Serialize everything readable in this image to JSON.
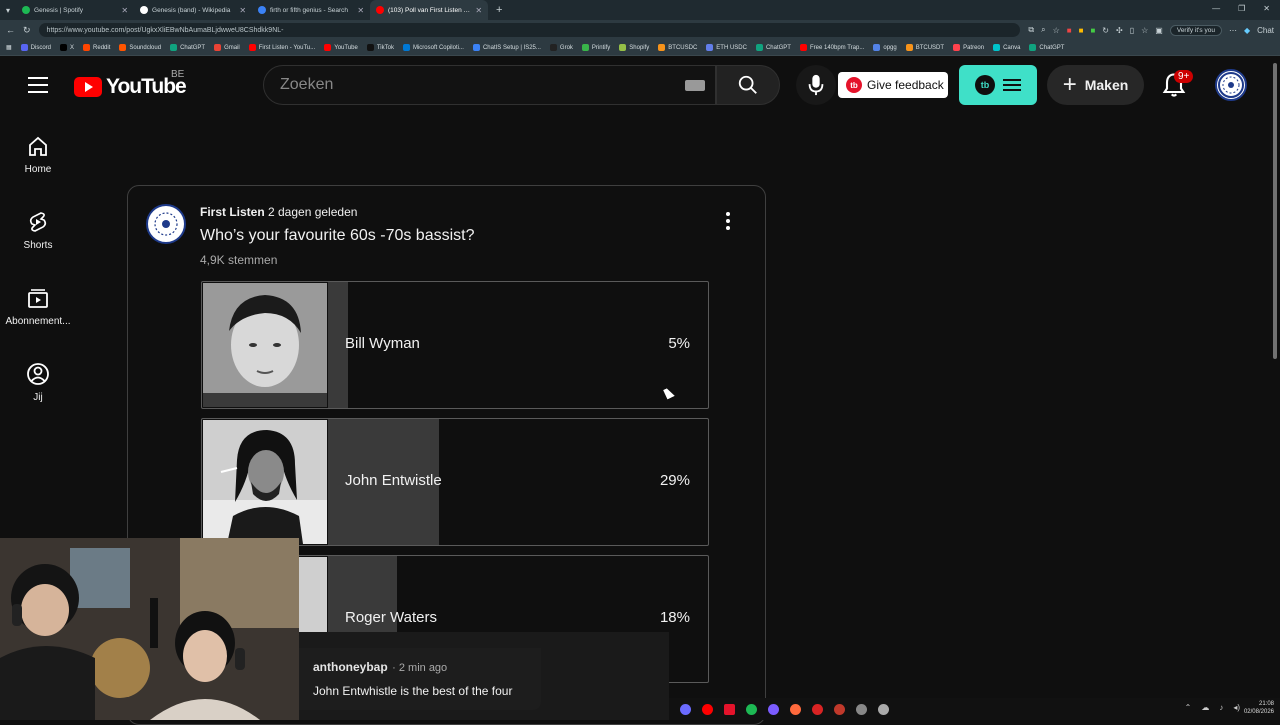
{
  "browser": {
    "tabs": [
      {
        "title": "Genesis | Spotify",
        "favicon_color": "#1db954",
        "active": false
      },
      {
        "title": "Genesis (band) - Wikipedia",
        "favicon_color": "#ffffff",
        "active": false
      },
      {
        "title": "firth or fifth genius - Search",
        "favicon_color": "#3b82f6",
        "active": false
      },
      {
        "title": "(103) Poll van First Listen - YouTub",
        "favicon_color": "#ff0000",
        "active": true
      }
    ],
    "url": "https://www.youtube.com/post/UgkxXliEBwNbAumaBLjdwweU8CShdkk9NL-",
    "verify_label": "Verify it's you",
    "chat_label": "Chat",
    "bookmarks": [
      {
        "label": "Discord",
        "color": "#5865f2"
      },
      {
        "label": "X",
        "color": "#000000"
      },
      {
        "label": "Reddit",
        "color": "#ff4500"
      },
      {
        "label": "Soundcloud",
        "color": "#ff5500"
      },
      {
        "label": "ChatGPT",
        "color": "#10a37f"
      },
      {
        "label": "Gmail",
        "color": "#ea4335"
      },
      {
        "label": "First Listen - YouTu...",
        "color": "#ff0000"
      },
      {
        "label": "YouTube",
        "color": "#ff0000"
      },
      {
        "label": "TikTok",
        "color": "#111111"
      },
      {
        "label": "Microsoft Copiloti...",
        "color": "#0078d4"
      },
      {
        "label": "ChatIS Setup | IS25...",
        "color": "#3b82f6"
      },
      {
        "label": "Grok",
        "color": "#222222"
      },
      {
        "label": "Printify",
        "color": "#39b54a"
      },
      {
        "label": "Shopify",
        "color": "#95bf47"
      },
      {
        "label": "BTCUSDC",
        "color": "#f7931a"
      },
      {
        "label": "ETH USDC",
        "color": "#627eea"
      },
      {
        "label": "ChatGPT",
        "color": "#10a37f"
      },
      {
        "label": "Free 140bpm Trap...",
        "color": "#ff0000"
      },
      {
        "label": "opgg",
        "color": "#5383e8"
      },
      {
        "label": "BTCUSDT",
        "color": "#f7931a"
      },
      {
        "label": "Patreon",
        "color": "#ff424d"
      },
      {
        "label": "Canva",
        "color": "#00c4cc"
      },
      {
        "label": "ChatGPT",
        "color": "#10a37f"
      }
    ]
  },
  "header": {
    "logo_text": "YouTube",
    "country": "BE",
    "search_placeholder": "Zoeken",
    "feedback_label": "Give feedback",
    "feedback_logo": "tb",
    "create_label": "Maken",
    "notif_badge": "9+"
  },
  "sidebar": {
    "items": [
      {
        "label": "Home",
        "icon": "home-icon"
      },
      {
        "label": "Shorts",
        "icon": "shorts-icon"
      },
      {
        "label": "Abonnement...",
        "icon": "subscriptions-icon"
      },
      {
        "label": "Jij",
        "icon": "you-icon"
      }
    ]
  },
  "post": {
    "channel": "First Listen",
    "time": "2 dagen geleden",
    "question": "Who’s your favourite 60s -70s bassist?",
    "votes": "4,9K stemmen",
    "options": [
      {
        "name": "Bill Wyman",
        "percent_label": "5%",
        "percent": 5
      },
      {
        "name": "John Entwistle",
        "percent_label": "29%",
        "percent": 29
      },
      {
        "name": "Roger Waters",
        "percent_label": "18%",
        "percent": 18
      }
    ]
  },
  "chat_overlay": {
    "user": "anthoneybap",
    "time": "2 min ago",
    "message": "John Entwhistle is the best of the four"
  },
  "taskbar": {
    "time": "21:08",
    "date": "02/08/2026"
  }
}
